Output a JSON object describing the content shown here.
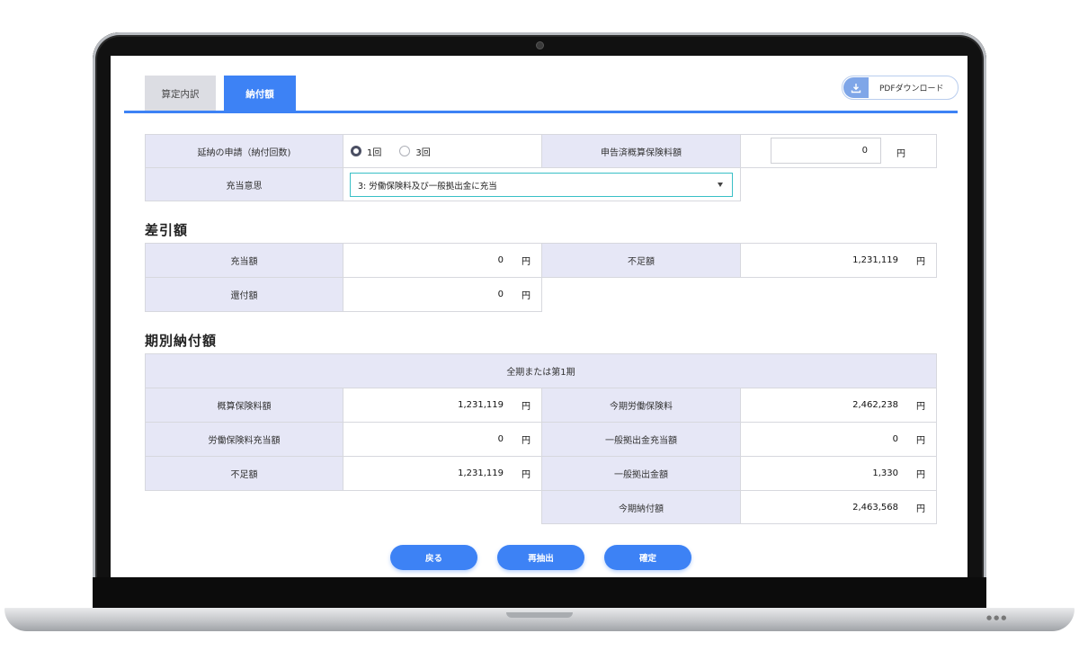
{
  "tabs": [
    {
      "label": "算定内訳"
    },
    {
      "label": "納付額"
    }
  ],
  "pdf_download_label": "PDFダウンロード",
  "form": {
    "deferred_payment_label": "延納の申請（納付回数)",
    "option_1": "1回",
    "option_3": "3回",
    "selected_option": "1回",
    "declared_premium_label": "申告済概算保険料額",
    "declared_premium_value": "0",
    "appropriation_label": "充当意思",
    "appropriation_value": "3: 労働保険料及び一般拠出金に充当"
  },
  "difference": {
    "heading": "差引額",
    "appropriated_label": "充当額",
    "appropriated_value": "0",
    "shortfall_label": "不足額",
    "shortfall_value": "1,231,119",
    "refund_label": "還付額",
    "refund_value": "0"
  },
  "installments": {
    "heading": "期別納付額",
    "period_header": "全期または第1期",
    "rows": {
      "estimated_label": "概算保険料額",
      "estimated_value": "1,231,119",
      "current_labor_label": "今期労働保険料",
      "current_labor_value": "2,462,238",
      "labor_appropriation_label": "労働保険料充当額",
      "labor_appropriation_value": "0",
      "general_appropriation_label": "一般拠出金充当額",
      "general_appropriation_value": "0",
      "shortfall_label": "不足額",
      "shortfall_value": "1,231,119",
      "general_contribution_label": "一般拠出金額",
      "general_contribution_value": "1,330",
      "current_total_label": "今期納付額",
      "current_total_value": "2,463,568"
    }
  },
  "currency_unit": "円",
  "buttons": {
    "back": "戻る",
    "re_extract": "再抽出",
    "confirm": "確定"
  },
  "colors": {
    "accent": "#3d82f5",
    "label_bg": "#e6e7f6",
    "select_border": "#39c0c6"
  },
  "icons": {
    "download": "download-icon",
    "dropdown": "caret-down-icon"
  }
}
